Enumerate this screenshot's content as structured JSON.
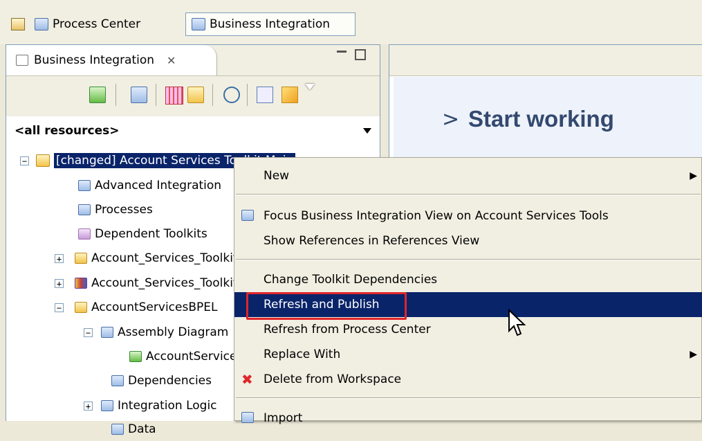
{
  "perspectives": [
    {
      "label": "Process Center",
      "icon": "process-center-icon"
    },
    {
      "label": "Business Integration",
      "icon": "business-integration-icon",
      "active": true
    }
  ],
  "left_view": {
    "tab_title": "Business Integration",
    "filter": "<all resources>",
    "tree": [
      {
        "label": "[changed] Account Services Toolkit Main",
        "expander": "minus",
        "selected": true
      },
      {
        "label": "Advanced Integration"
      },
      {
        "label": "Processes"
      },
      {
        "label": "Dependent Toolkits"
      },
      {
        "label": "Account_Services_Toolkit",
        "expander": "plus"
      },
      {
        "label": "Account_Services_Toolkit",
        "expander": "plus"
      },
      {
        "label": "AccountServicesBPEL",
        "expander": "minus"
      },
      {
        "label": "Assembly Diagram",
        "expander": "minus"
      },
      {
        "label": "AccountServices"
      },
      {
        "label": "Dependencies"
      },
      {
        "label": "Integration Logic",
        "expander": "plus"
      },
      {
        "label": "Data"
      }
    ]
  },
  "right_view": {
    "heading": "Start working",
    "chevron": ">"
  },
  "context_menu": {
    "items": [
      {
        "label": "New",
        "submenu": true
      },
      {
        "type": "separator"
      },
      {
        "label": "Focus Business Integration View on Account Services Tools",
        "icon": "focus-icon"
      },
      {
        "label": "Show References in References View"
      },
      {
        "type": "separator"
      },
      {
        "label": "Change Toolkit Dependencies"
      },
      {
        "label": "Refresh and Publish",
        "highlighted": true
      },
      {
        "label": "Refresh from Process Center"
      },
      {
        "label": "Replace With",
        "submenu": true
      },
      {
        "label": "Delete from Workspace",
        "icon": "delete-icon"
      },
      {
        "type": "separator"
      },
      {
        "label": "Import",
        "icon": "import-icon"
      }
    ]
  },
  "colors": {
    "selection": "#0a246a",
    "callout": "#e0262b",
    "heading": "#33496e"
  }
}
